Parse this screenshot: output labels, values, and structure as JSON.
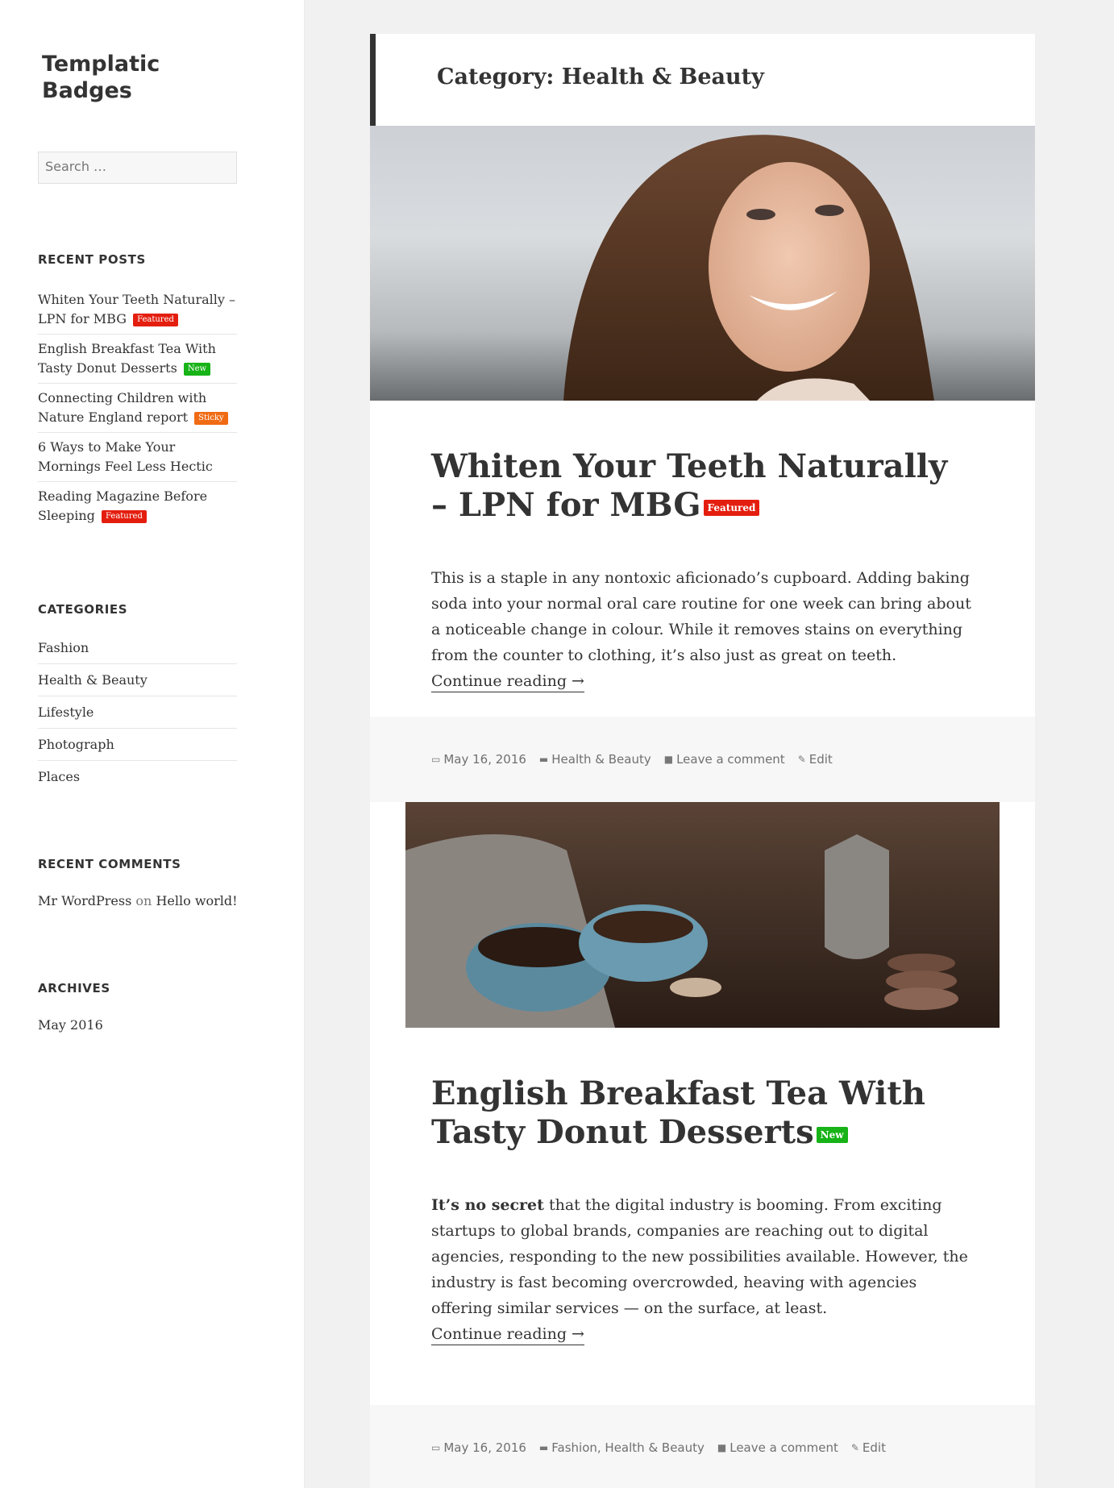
{
  "site": {
    "title": "Templatic Badges"
  },
  "search": {
    "placeholder": "Search …"
  },
  "recent_posts": {
    "title": "RECENT POSTS",
    "items": [
      {
        "label": "Whiten Your Teeth Naturally – LPN for MBG",
        "badge": "Featured"
      },
      {
        "label": "English Breakfast Tea With Tasty Donut Desserts",
        "badge": "New"
      },
      {
        "label": "Connecting Children with Nature England report",
        "badge": "Sticky"
      },
      {
        "label": "6 Ways to Make Your Mornings Feel Less Hectic",
        "badge": ""
      },
      {
        "label": "Reading Magazine Before Sleeping",
        "badge": "Featured"
      }
    ]
  },
  "categories": {
    "title": "CATEGORIES",
    "items": [
      "Fashion",
      "Health & Beauty",
      "Lifestyle",
      "Photograph",
      "Places"
    ]
  },
  "recent_comments": {
    "title": "RECENT COMMENTS",
    "author": "Mr WordPress",
    "on": "on",
    "post": "Hello world!"
  },
  "archives": {
    "title": "ARCHIVES",
    "items": [
      "May 2016"
    ]
  },
  "page_header": "Category: Health & Beauty",
  "posts": [
    {
      "title": "Whiten Your Teeth Naturally – LPN for MBG",
      "badge": "Featured",
      "excerpt_lead": "",
      "excerpt": "This is a staple in any nontoxic aficionado’s cupboard. Adding baking soda into your normal oral care routine for one week can bring about a noticeable change in colour. While it removes stains on everything from the counter to clothing, it’s also just as great on teeth.",
      "more": "Continue reading →",
      "date": "May 16, 2016",
      "cats": "Health & Beauty",
      "comments": "Leave a comment",
      "edit": "Edit"
    },
    {
      "title": "English Breakfast Tea With Tasty Donut Desserts",
      "badge": "New",
      "excerpt_lead": "It’s no secret",
      "excerpt": " that the digital industry is booming. From exciting startups to global brands, companies are reaching out to digital agencies, responding to the new possibilities available. However, the industry is fast becoming overcrowded, heaving with agencies offering similar services — on the surface, at least.",
      "more": "Continue reading →",
      "date": "May 16, 2016",
      "cats": "Fashion, Health & Beauty",
      "comments": "Leave a comment",
      "edit": "Edit"
    }
  ],
  "colors": {
    "featured": "#e41e0f",
    "new": "#17b317",
    "sticky": "#f06b14"
  }
}
